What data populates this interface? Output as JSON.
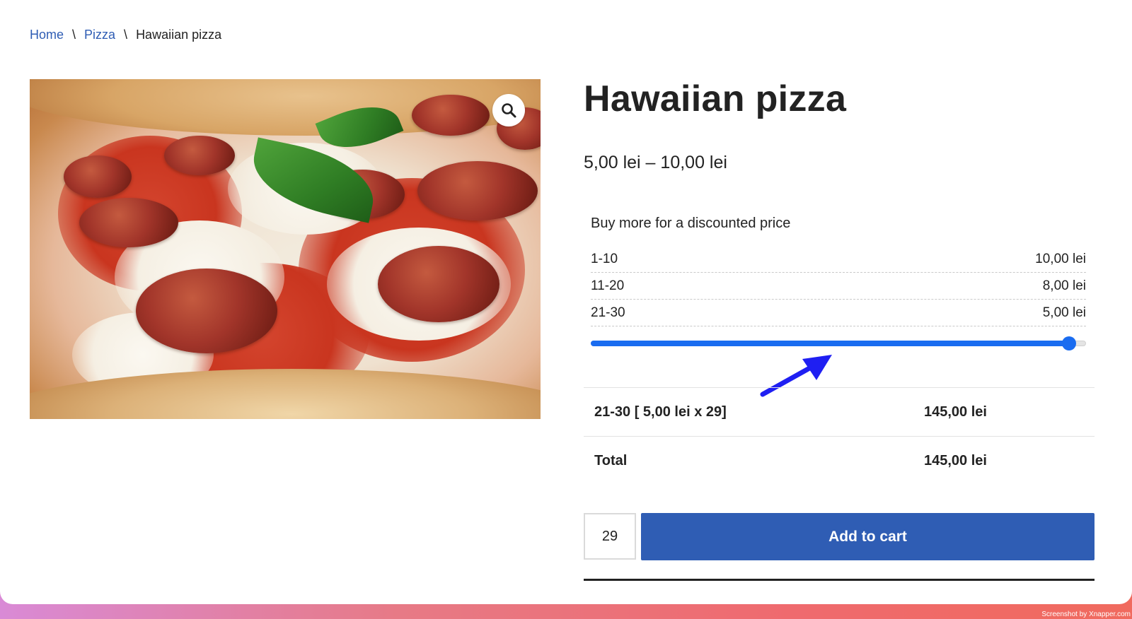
{
  "breadcrumb": {
    "items": [
      "Home",
      "Pizza"
    ],
    "separator": "\\",
    "current": "Hawaiian pizza"
  },
  "product": {
    "title": "Hawaiian pizza",
    "price_range": "5,00 lei – 10,00 lei",
    "image_alt": "Pizza with pepperoni and basil",
    "zoom_icon": "search-icon"
  },
  "discount": {
    "heading": "Buy more for a discounted price",
    "tiers": [
      {
        "range": "1-10",
        "price": "10,00 lei"
      },
      {
        "range": "11-20",
        "price": "8,00 lei"
      },
      {
        "range": "21-30",
        "price": "5,00 lei"
      }
    ],
    "slider": {
      "min": 1,
      "max": 30,
      "value": 29,
      "fill_color": "#1a6cf0"
    }
  },
  "summary": {
    "line_label": "21-30 [ 5,00 lei x 29]",
    "line_value": "145,00 lei",
    "total_label": "Total",
    "total_value": "145,00 lei"
  },
  "cart": {
    "quantity": "29",
    "button_label": "Add to cart",
    "button_color": "#2f5db4"
  },
  "footer": {
    "watermark": "Screenshot by Xnapper.com"
  }
}
